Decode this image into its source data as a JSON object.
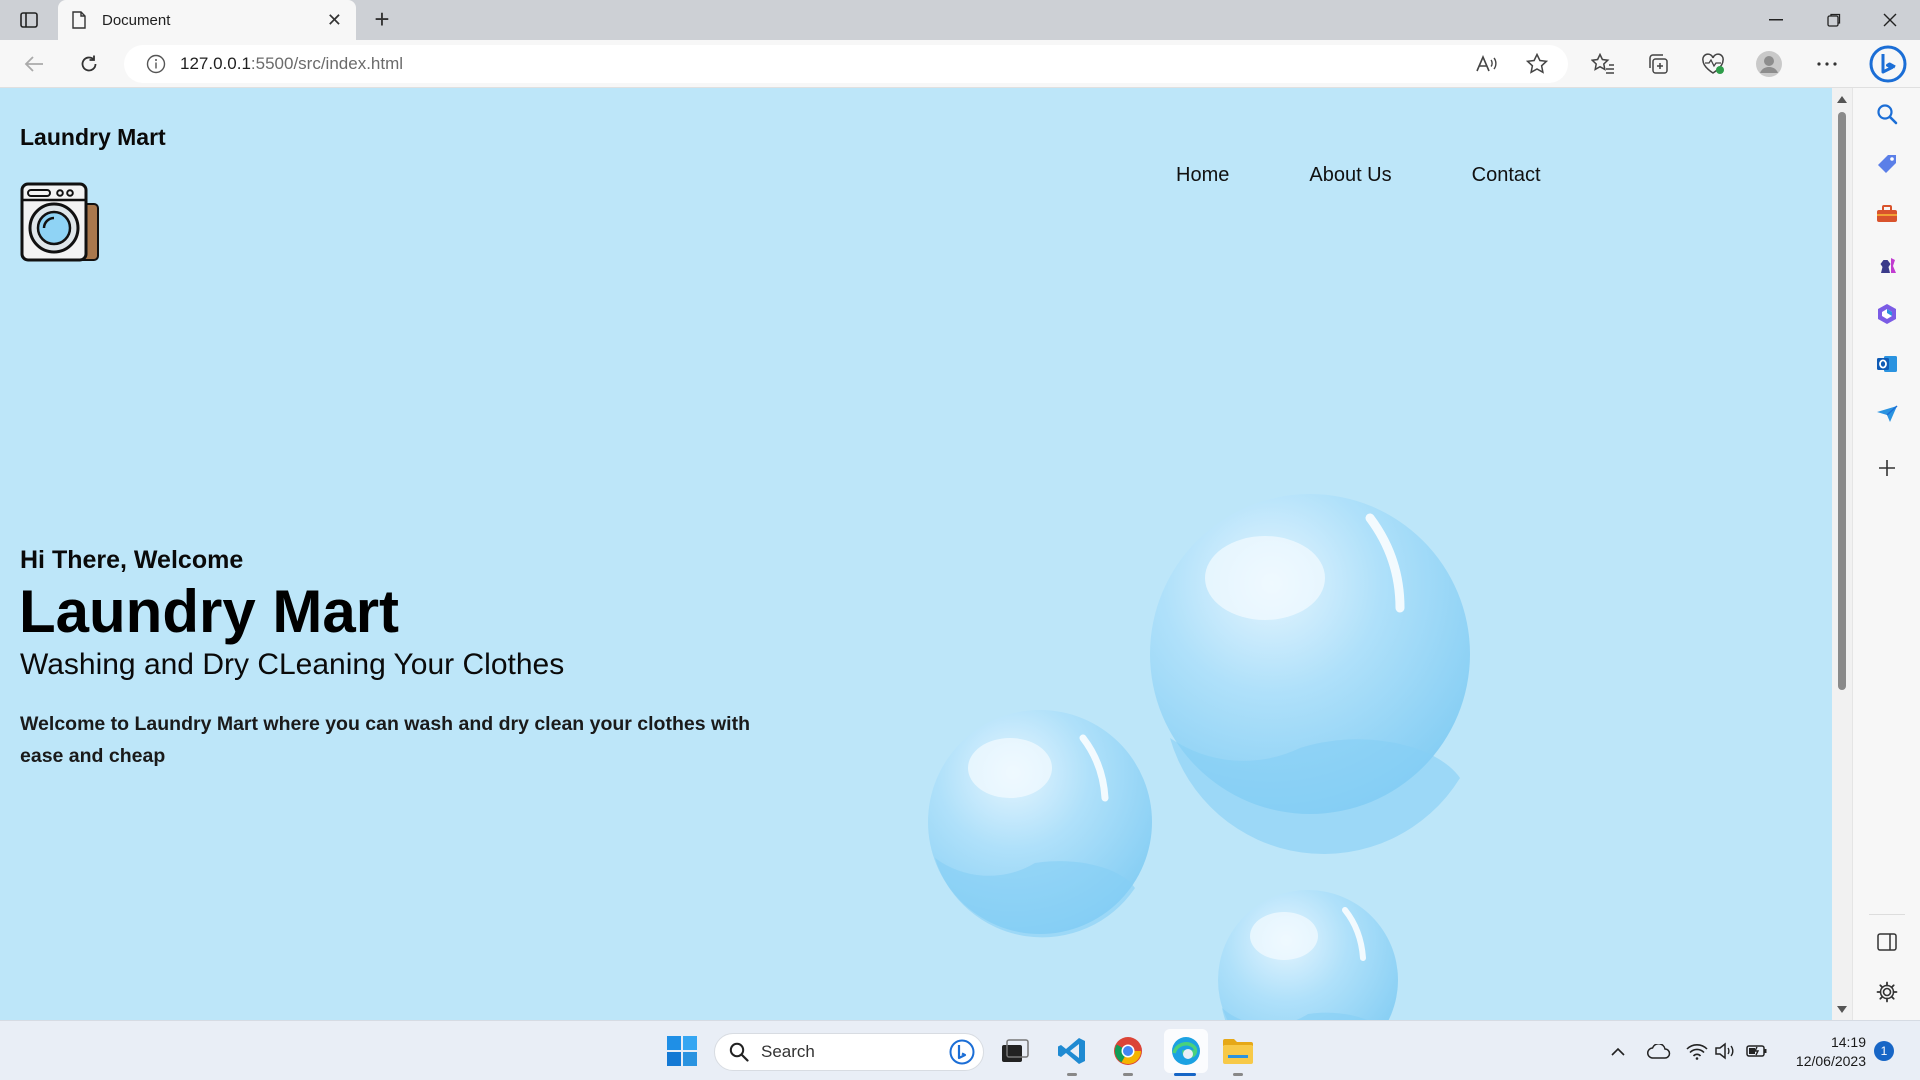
{
  "browser": {
    "tab_title": "Document",
    "url_host": "127.0.0.1",
    "url_path": ":5500/src/index.html"
  },
  "site": {
    "brand": "Laundry Mart",
    "nav": [
      "Home",
      "About Us",
      "Contact"
    ],
    "hero": {
      "greeting": "Hi There, Welcome",
      "title": "Laundry Mart",
      "subtitle": "Washing and Dry CLeaning Your Clothes",
      "description": "Welcome to Laundry Mart where you can wash and dry clean your clothes with ease and cheap"
    }
  },
  "taskbar": {
    "search_label": "Search",
    "time": "14:19",
    "date": "12/06/2023",
    "notification_count": "1"
  },
  "colors": {
    "page_background": "#bde6f9",
    "bubble": "#8fd3f5",
    "notification_badge": "#1766c6"
  }
}
